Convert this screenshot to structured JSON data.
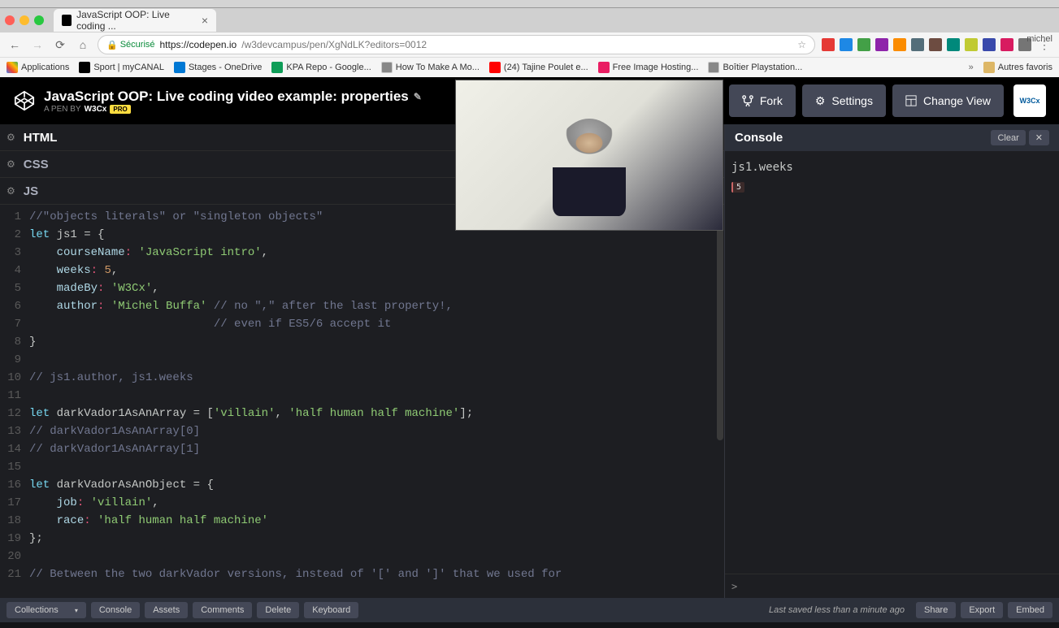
{
  "browser": {
    "tab_title": "JavaScript OOP: Live coding ...",
    "url_secure_label": "Sécurisé",
    "url_host": "https://codepen.io",
    "url_path": "/w3devcampus/pen/XgNdLK?editors=0012",
    "user": "michel",
    "bookmarks": [
      {
        "label": "Applications",
        "color": "#4285f4"
      },
      {
        "label": "Sport | myCANAL",
        "color": "#000"
      },
      {
        "label": "Stages - OneDrive",
        "color": "#0078d4"
      },
      {
        "label": "KPA Repo - Google...",
        "color": "#0f9d58"
      },
      {
        "label": "How To Make A Mo...",
        "color": "#888"
      },
      {
        "label": "(24) Tajine Poulet e...",
        "color": "#ff0000"
      },
      {
        "label": "Free Image Hosting...",
        "color": "#e91e63"
      },
      {
        "label": "Boîtier Playstation...",
        "color": "#888"
      },
      {
        "label": "Autres favoris",
        "color": "#888"
      }
    ]
  },
  "codepen": {
    "title": "JavaScript OOP: Live coding video example: properties",
    "subtitle_prefix": "A PEN BY",
    "author": "W3Cx",
    "pro_label": "PRO",
    "actions": {
      "fork": "Fork",
      "settings": "Settings",
      "change_view": "Change View"
    },
    "avatar_text": "W3Cx"
  },
  "panels": {
    "html": "HTML",
    "css": "CSS",
    "js": "JS"
  },
  "code_lines": [
    {
      "n": 1,
      "raw": "//\"objects literals\" or \"singleton objects\""
    },
    {
      "n": 2,
      "raw": "let js1 = {"
    },
    {
      "n": 3,
      "raw": "    courseName: 'JavaScript intro',"
    },
    {
      "n": 4,
      "raw": "    weeks: 5,"
    },
    {
      "n": 5,
      "raw": "    madeBy: 'W3Cx',"
    },
    {
      "n": 6,
      "raw": "    author: 'Michel Buffa' // no \",\" after the last property!,"
    },
    {
      "n": 7,
      "raw": "                           // even if ES5/6 accept it"
    },
    {
      "n": 8,
      "raw": "}"
    },
    {
      "n": 9,
      "raw": ""
    },
    {
      "n": 10,
      "raw": "// js1.author, js1.weeks"
    },
    {
      "n": 11,
      "raw": ""
    },
    {
      "n": 12,
      "raw": "let darkVador1AsAnArray = ['villain', 'half human half machine'];"
    },
    {
      "n": 13,
      "raw": "// darkVador1AsAnArray[0]"
    },
    {
      "n": 14,
      "raw": "// darkVador1AsAnArray[1]"
    },
    {
      "n": 15,
      "raw": ""
    },
    {
      "n": 16,
      "raw": "let darkVadorAsAnObject = {"
    },
    {
      "n": 17,
      "raw": "    job: 'villain',"
    },
    {
      "n": 18,
      "raw": "    race: 'half human half machine'"
    },
    {
      "n": 19,
      "raw": "};"
    },
    {
      "n": 20,
      "raw": ""
    },
    {
      "n": 21,
      "raw": "// Between the two darkVador versions, instead of '[' and ']' that we used for"
    }
  ],
  "console": {
    "title": "Console",
    "clear": "Clear",
    "log": "js1.weeks",
    "result": "5",
    "prompt": ">"
  },
  "bottom": {
    "collections": "Collections",
    "console": "Console",
    "assets": "Assets",
    "comments": "Comments",
    "delete": "Delete",
    "keyboard": "Keyboard",
    "status": "Last saved less than a minute ago",
    "share": "Share",
    "export": "Export",
    "embed": "Embed"
  }
}
